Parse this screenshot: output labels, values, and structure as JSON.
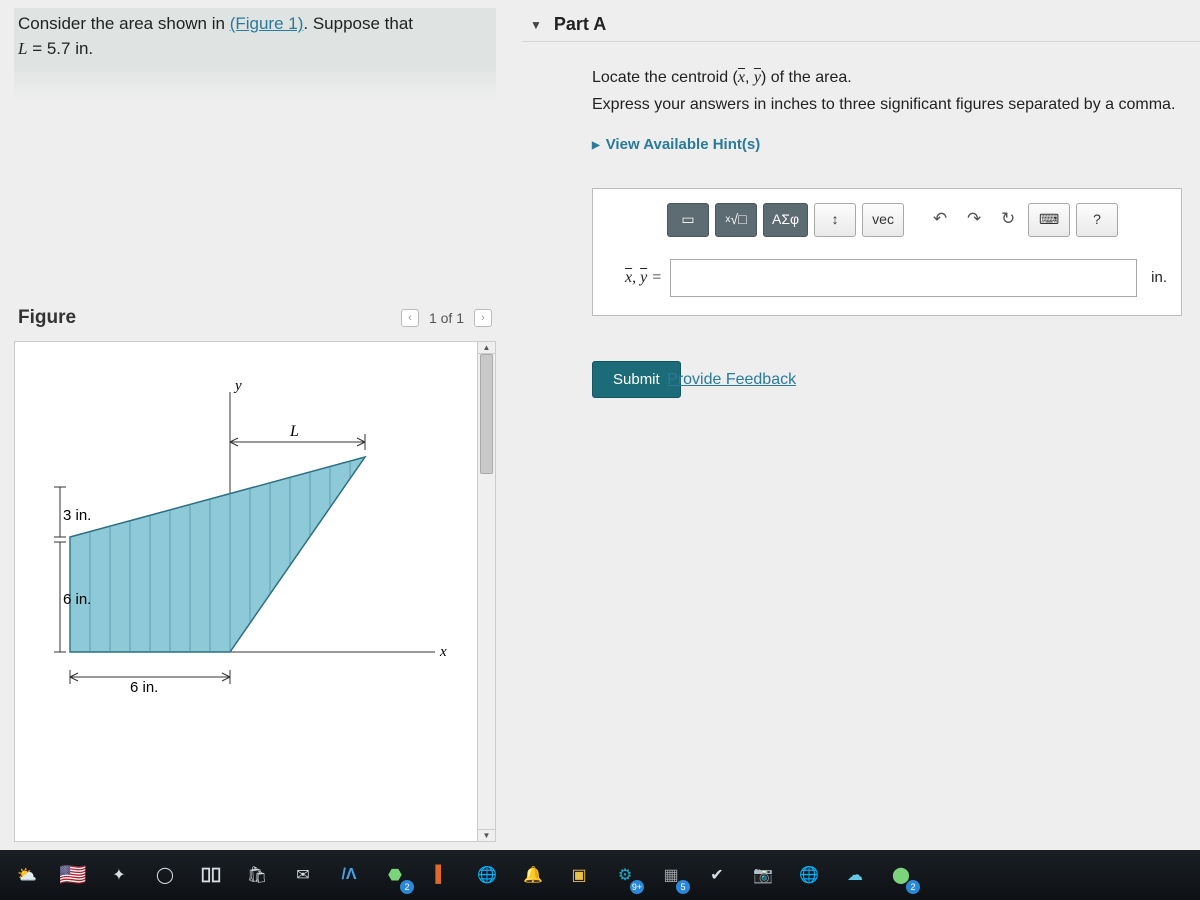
{
  "problem": {
    "prefix": "Consider the area shown in ",
    "figure_link": "(Figure 1)",
    "suffix": ". Suppose that",
    "param_line_html": "L = 5.7 in."
  },
  "figure": {
    "title": "Figure",
    "pager": "1 of 1",
    "labels": {
      "y": "y",
      "x": "x",
      "L": "L",
      "dim_top_left": "3 in.",
      "dim_bottom_left": "6 in.",
      "dim_bottom": "6 in."
    }
  },
  "part": {
    "label": "Part A",
    "line1_pre": "Locate the centroid (",
    "line1_x": "x",
    "line1_sep": ", ",
    "line1_y": "y",
    "line1_post": ") of the area.",
    "line2": "Express your answers in inches to three significant figures separated by a comma.",
    "hints": "View Available Hint(s)",
    "toolbar": {
      "templates": "▭",
      "sqrt": "√□",
      "greek": "ΑΣφ",
      "updown": "↕",
      "vec": "vec",
      "undo": "↶",
      "redo": "↷",
      "reset": "↻",
      "keyboard": "⌨",
      "help": "?"
    },
    "lhs": "x̄, ȳ =",
    "input_value": "",
    "unit": "in.",
    "submit": "Submit"
  },
  "feedback": "Provide Feedback",
  "taskbar_badges": {
    "b1": "2",
    "b2": "9+",
    "b3": "5",
    "b4": "2"
  }
}
